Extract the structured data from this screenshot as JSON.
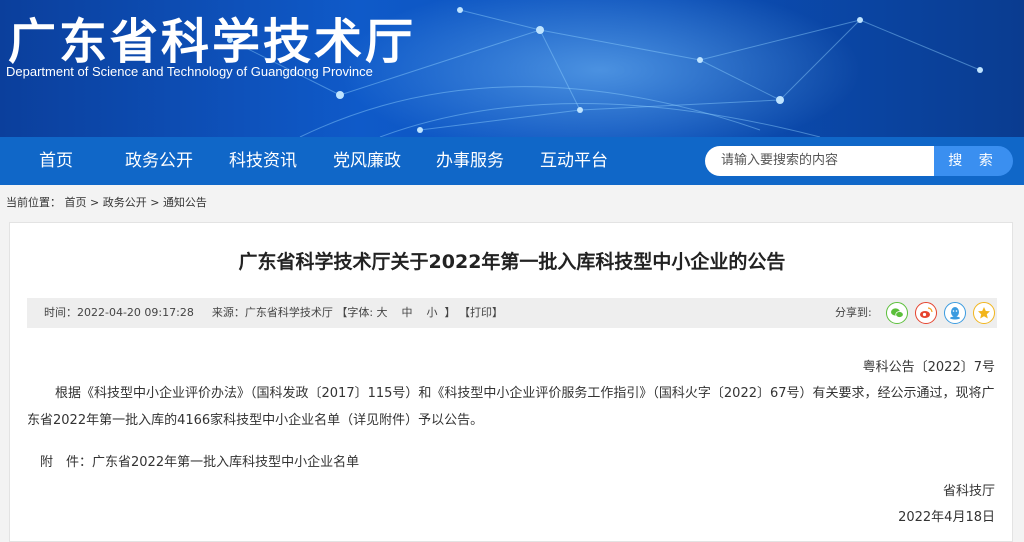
{
  "header": {
    "title": "广东省科学技术厅",
    "subtitle": "Department of Science and Technology of Guangdong Province"
  },
  "nav": {
    "items": [
      "首页",
      "政务公开",
      "科技资讯",
      "党风廉政",
      "办事服务",
      "互动平台"
    ]
  },
  "search": {
    "placeholder": "请输入要搜索的内容",
    "button_label": "搜 索"
  },
  "breadcrumb": {
    "prefix": "当前位置：",
    "items": [
      "首页",
      "政务公开",
      "通知公告"
    ],
    "separator": ">"
  },
  "article": {
    "title": "广东省科学技术厅关于2022年第一批入库科技型中小企业的公告",
    "meta": {
      "time": "时间：2022-04-20 09:17:28",
      "source": "来源：广东省科学技术厅",
      "font_label": "【字体:",
      "font_large": "大",
      "font_medium": "中",
      "font_small": "小",
      "font_close": "】",
      "print": "【打印】"
    },
    "share": {
      "label": "分享到:",
      "icons": [
        "wechat-icon",
        "weibo-icon",
        "qq-icon",
        "qzone-icon"
      ]
    },
    "doc_number": "粤科公告〔2022〕7号",
    "body": "根据《科技型中小企业评价办法》（国科发政〔2017〕115号）和《科技型中小企业评价服务工作指引》（国科火字〔2022〕67号）有关要求，经公示通过，现将广东省2022年第一批入库的4166家科技型中小企业名单（详见附件）予以公告。",
    "attachment": "附　件：广东省2022年第一批入库科技型中小企业名单",
    "signature": "省科技厅",
    "date": "2022年4月18日"
  },
  "colors": {
    "banner": "#0f5ac9",
    "nav": "#1067c8",
    "search_button": "#3a8ff0",
    "wechat": "#5bbf3a",
    "weibo": "#e6432e",
    "qq": "#3a9be0",
    "qzone": "#f2b51c"
  }
}
